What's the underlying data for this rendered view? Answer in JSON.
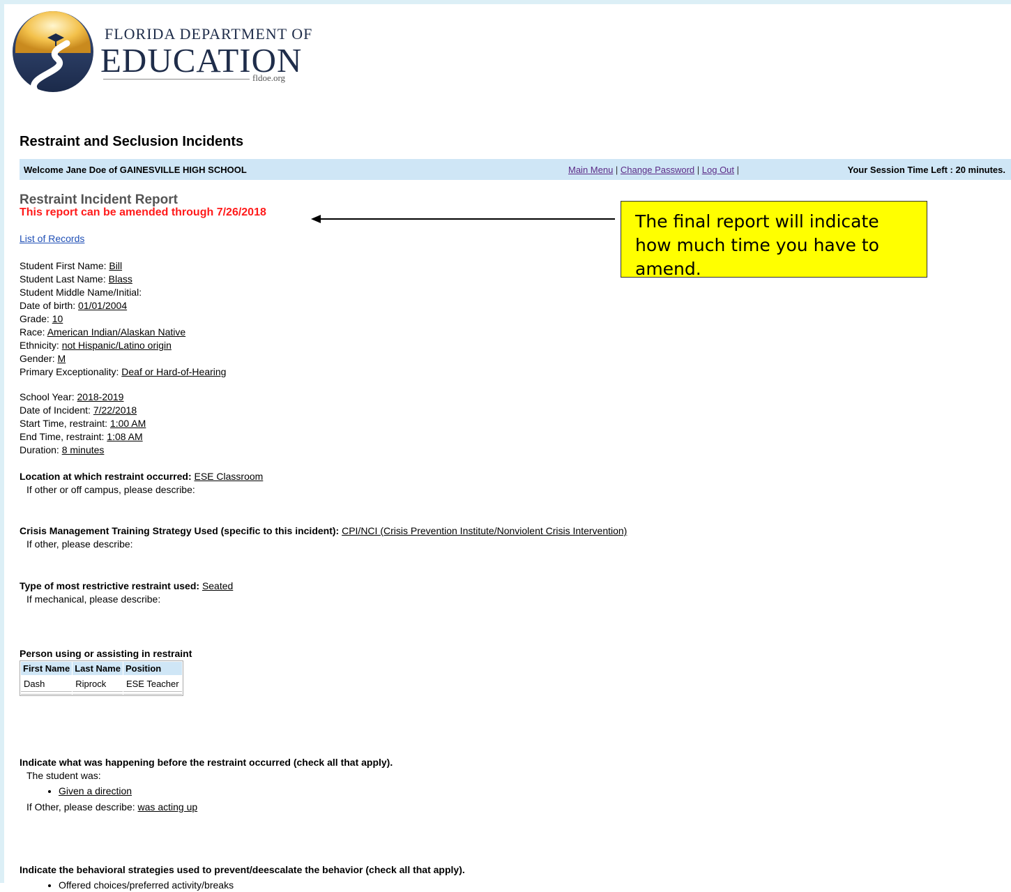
{
  "logo": {
    "top_line": "FLORIDA DEPARTMENT OF",
    "main": "EDUCATION",
    "domain": "fldoe.org"
  },
  "page_title": "Restraint and Seclusion Incidents",
  "navbar": {
    "welcome": "Welcome Jane Doe of GAINESVILLE HIGH SCHOOL",
    "main_menu": "Main Menu",
    "change_password": "Change Password",
    "log_out": "Log Out",
    "session": "Your Session Time Left : 20 minutes."
  },
  "report": {
    "title": "Restraint Incident Report",
    "amend_note": "This report can be amended through 7/26/2018",
    "list_link": "List of Records"
  },
  "callout": {
    "text": "The final report will indicate how much time you have to amend."
  },
  "student": [
    {
      "label": "Student First Name: ",
      "value": "Bill"
    },
    {
      "label": "Student Last Name: ",
      "value": "Blass"
    },
    {
      "label": "Student Middle Name/Initial:",
      "value": ""
    },
    {
      "label": "Date of birth: ",
      "value": "01/01/2004"
    },
    {
      "label": "Grade: ",
      "value": "10"
    },
    {
      "label": "Race: ",
      "value": "American Indian/Alaskan Native"
    },
    {
      "label": "Ethnicity: ",
      "value": "not Hispanic/Latino origin"
    },
    {
      "label": "Gender: ",
      "value": "M"
    },
    {
      "label": "Primary Exceptionality: ",
      "value": "Deaf or Hard-of-Hearing"
    }
  ],
  "incident": [
    {
      "label": "School Year: ",
      "value": "2018-2019"
    },
    {
      "label": "Date of Incident: ",
      "value": "7/22/2018"
    },
    {
      "label": "Start Time, restraint: ",
      "value": "1:00 AM"
    },
    {
      "label": "End Time, restraint: ",
      "value": "1:08 AM"
    },
    {
      "label": "Duration: ",
      "value": "8 minutes"
    }
  ],
  "location": {
    "label": "Location at which restraint occurred: ",
    "value": "ESE Classroom",
    "sub": "If other or off campus, please describe:"
  },
  "crisis": {
    "label": "Crisis Management Training Strategy Used (specific to this incident): ",
    "value": "CPI/NCI (Crisis Prevention Institute/Nonviolent Crisis Intervention)",
    "sub": "If other, please describe:"
  },
  "restraint_type": {
    "label": "Type of most restrictive restraint used: ",
    "value": "Seated",
    "sub": "If mechanical, please describe:"
  },
  "persons": {
    "heading": "Person using or assisting in restraint",
    "headers": [
      "First Name",
      "Last Name",
      "Position"
    ],
    "rows": [
      [
        "Dash",
        "Riprock",
        "ESE Teacher"
      ]
    ]
  },
  "before": {
    "heading": "Indicate what was happening before the restraint occurred (check all that apply).",
    "sub": "The student was:",
    "items": [
      "Given a direction"
    ],
    "other_label": "If Other, please describe: ",
    "other_value": "was acting up"
  },
  "strategies": {
    "heading": "Indicate the behavioral strategies used to prevent/deescalate the behavior (check all that apply).",
    "items": [
      "Offered choices/preferred activity/breaks"
    ]
  }
}
